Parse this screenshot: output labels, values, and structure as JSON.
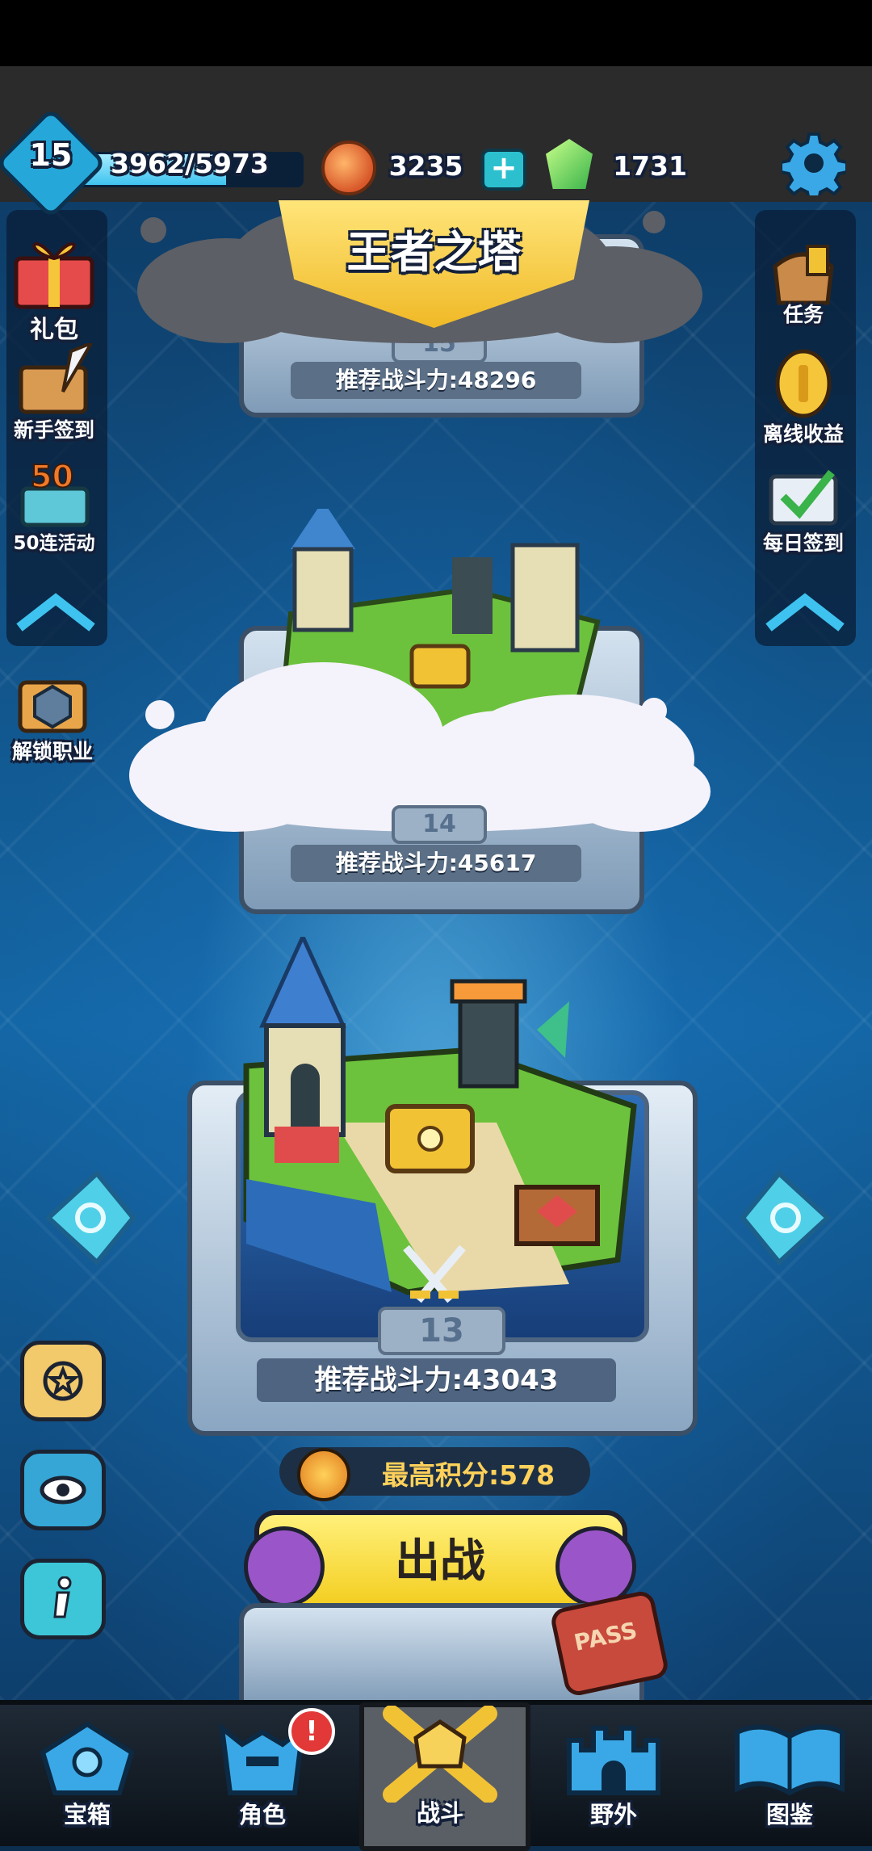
{
  "hud": {
    "level": "15",
    "xp_text": "3962/5973",
    "xp_progress": 0.66,
    "coins": "3235",
    "gems": "1731"
  },
  "title": "王者之塔",
  "left_menu": [
    {
      "label": "礼包",
      "icon": "gift-box-icon"
    },
    {
      "label": "新手签到",
      "icon": "quill-scroll-icon"
    },
    {
      "label": "50连活动",
      "icon": "fifty-chest-icon"
    },
    {
      "label": "解锁职业",
      "icon": "class-unlock-icon"
    }
  ],
  "right_menu": [
    {
      "label": "任务",
      "icon": "quest-bag-icon"
    },
    {
      "label": "离线收益",
      "icon": "offline-coin-icon"
    },
    {
      "label": "每日签到",
      "icon": "daily-checkin-icon"
    }
  ],
  "stages": {
    "top": {
      "number": "15",
      "power_text": "推荐战斗力:48296"
    },
    "middle": {
      "number": "14",
      "power_text": "推荐战斗力:45617"
    },
    "current": {
      "number": "13",
      "power_text": "推荐战斗力:43043"
    }
  },
  "high_score_text": "最高积分:578",
  "battle_button": "出战",
  "pass_badge": "PASS",
  "nav": [
    {
      "label": "宝箱",
      "icon": "treasure-chest-nav-icon"
    },
    {
      "label": "角色",
      "icon": "character-helmet-icon"
    },
    {
      "label": "战斗",
      "icon": "crossed-swords-icon"
    },
    {
      "label": "野外",
      "icon": "castle-icon"
    },
    {
      "label": "图鉴",
      "icon": "codex-book-icon"
    }
  ],
  "nav_badge": "!",
  "colors": {
    "accent_cyan": "#3ec3f0",
    "gold": "#f0b926",
    "nav_active": "#5a5f66"
  }
}
